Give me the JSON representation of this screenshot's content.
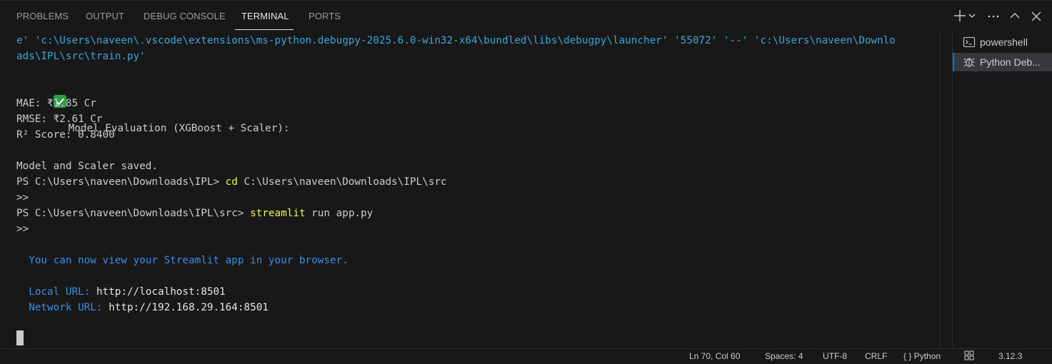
{
  "tabs": [
    {
      "label": "PROBLEMS"
    },
    {
      "label": "OUTPUT"
    },
    {
      "label": "DEBUG CONSOLE"
    },
    {
      "label": "TERMINAL",
      "active": true
    },
    {
      "label": "PORTS"
    }
  ],
  "toolbar_icons": [
    "plus-icon",
    "chevron-down-icon",
    "more-icon",
    "chevron-up-icon",
    "close-icon"
  ],
  "terminal": {
    "cmd_line_1": "e' 'c:\\Users\\naveen\\.vscode\\extensions\\ms-python.debugpy-2025.6.0-win32-x64\\bundled\\libs\\debugpy\\launcher' '55072' '--' 'c:\\Users\\naveen\\Downlo",
    "cmd_line_2": "ads\\IPL\\src\\train.py'",
    "eval_header": "Model Evaluation (XGBoost + Scaler):",
    "mae": "MAE: ₹1.85 Cr",
    "rmse": "RMSE: ₹2.61 Cr",
    "r2": "R² Score: 0.8400",
    "saved": "Model and Scaler saved.",
    "prompt1": "PS C:\\Users\\naveen\\Downloads\\IPL> ",
    "prompt1_cmd": "cd",
    "prompt1_args": " C:\\Users\\naveen\\Downloads\\IPL\\src",
    "continuation": ">>",
    "prompt2": "PS C:\\Users\\naveen\\Downloads\\IPL\\src> ",
    "prompt2_cmd": "streamlit",
    "prompt2_args": " run app.py",
    "streamlit_msg": "  You can now view your Streamlit app in your browser.",
    "local_label": "  Local URL: ",
    "local_url": "http://localhost:8501",
    "network_label": "  Network URL: ",
    "network_url": "http://192.168.29.164:8501"
  },
  "side_terminals": [
    {
      "label": "powershell",
      "icon": "terminal-icon"
    },
    {
      "label": "Python Deb...",
      "icon": "debug-icon",
      "selected": true
    }
  ],
  "statusbar": {
    "position": "Ln 70, Col 60",
    "spaces": "Spaces: 4",
    "encoding": "UTF-8",
    "eol": "CRLF",
    "language": "{ } Python",
    "version": "3.12.3"
  },
  "colors": {
    "background": "#181818",
    "cyan": "#3ea5d9",
    "blue": "#3b8eea",
    "yellow": "#f5f543",
    "check_green": "#2ea043",
    "selection": "#37373d"
  }
}
